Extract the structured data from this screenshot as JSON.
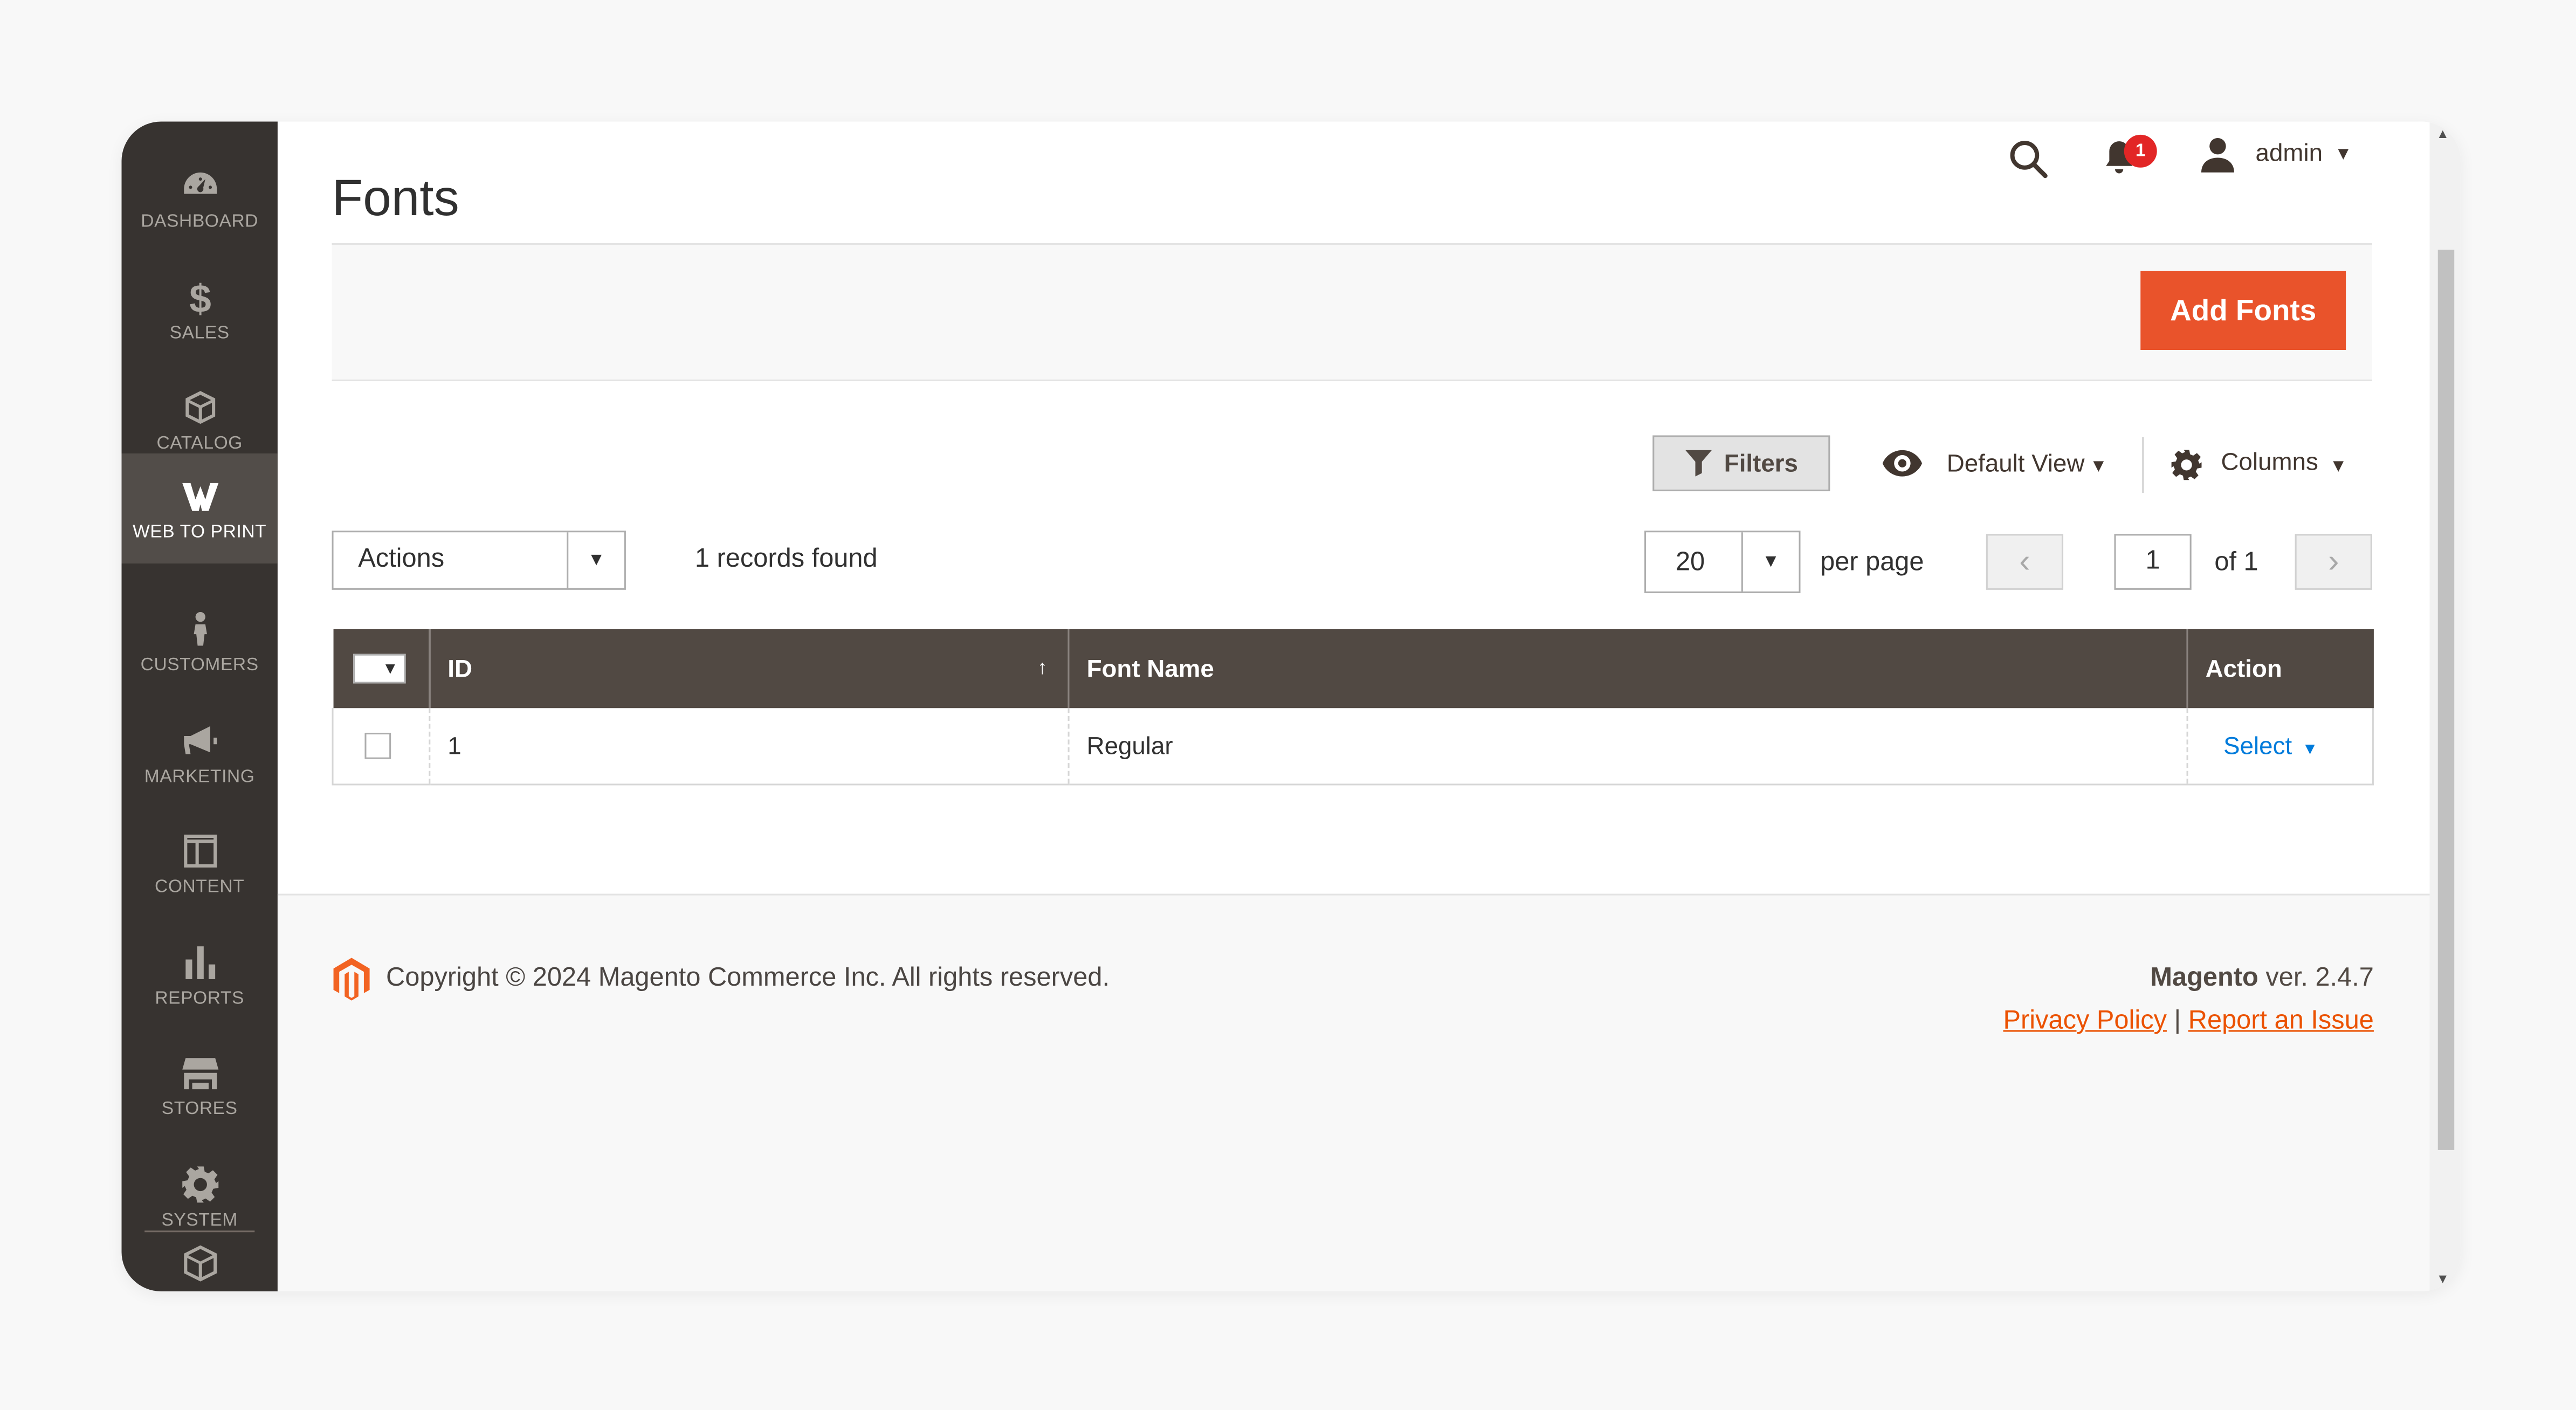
{
  "sidebar": {
    "items": [
      {
        "label": "DASHBOARD",
        "icon": "dashboard-icon"
      },
      {
        "label": "SALES",
        "icon": "dollar-icon"
      },
      {
        "label": "CATALOG",
        "icon": "box-icon"
      },
      {
        "label": "WEB TO PRINT",
        "icon": "w-logo-icon",
        "active": true
      },
      {
        "label": "CUSTOMERS",
        "icon": "person-icon"
      },
      {
        "label": "MARKETING",
        "icon": "megaphone-icon"
      },
      {
        "label": "CONTENT",
        "icon": "layout-icon"
      },
      {
        "label": "REPORTS",
        "icon": "bar-chart-icon"
      },
      {
        "label": "STORES",
        "icon": "storefront-icon"
      },
      {
        "label": "SYSTEM",
        "icon": "gear-icon"
      }
    ],
    "extra_icon": "extensions-cube-icon"
  },
  "header": {
    "title": "Fonts",
    "notifications_count": "1",
    "user": "admin"
  },
  "action_bar": {
    "add_label": "Add Fonts"
  },
  "toolbar": {
    "filters_label": "Filters",
    "view_label": "Default View",
    "columns_label": "Columns",
    "actions_label": "Actions",
    "records_found": "1 records found",
    "per_page_value": "20",
    "per_page_label": "per page",
    "page_value": "1",
    "page_of": "of 1"
  },
  "grid": {
    "columns": [
      "ID",
      "Font Name",
      "Action"
    ],
    "sort_indicator": "↑",
    "rows": [
      {
        "id": "1",
        "font_name": "Regular",
        "action": "Select"
      }
    ]
  },
  "footer": {
    "copyright": "Copyright © 2024 Magento Commerce Inc. All rights reserved.",
    "brand": "Magento",
    "version": " ver. 2.4.7",
    "privacy": "Privacy Policy",
    "separator": "|",
    "report": "Report an Issue"
  },
  "colors": {
    "sidebar_bg": "#373330",
    "sidebar_active": "#524d49",
    "accent": "#e9532b",
    "grid_header": "#514943",
    "link": "#007bdb"
  }
}
